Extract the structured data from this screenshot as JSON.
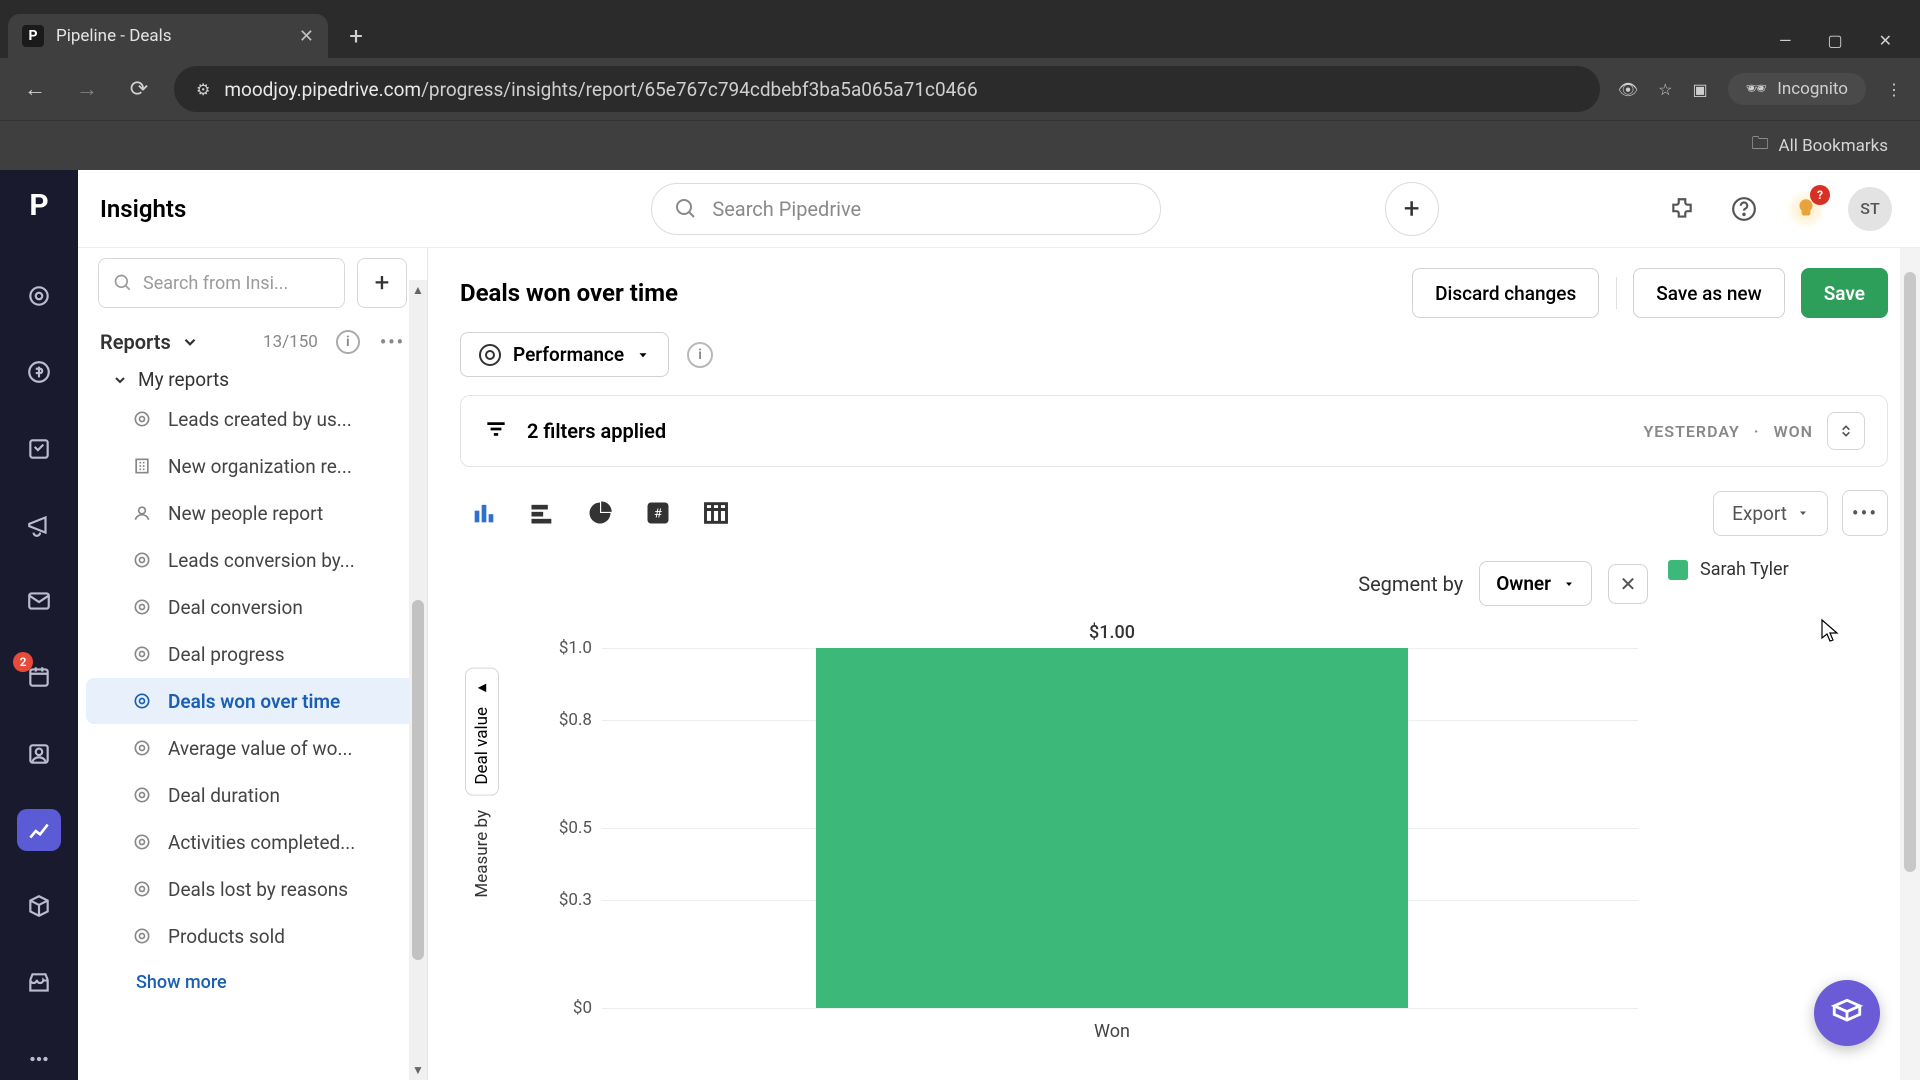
{
  "browser": {
    "tab_title": "Pipeline - Deals",
    "url_host": "moodjoy.pipedrive.com",
    "url_path": "/progress/insights/report/65e767c794cdbebf3ba5a065a71c0466",
    "incognito": "Incognito",
    "all_bookmarks": "All Bookmarks"
  },
  "topbar": {
    "section": "Insights",
    "search_placeholder": "Search Pipedrive",
    "avatar": "ST",
    "bulb_badge": "?"
  },
  "sidebar": {
    "search_placeholder": "Search from Insi...",
    "reports_label": "Reports",
    "reports_count": "13/150",
    "group": "My reports",
    "items": [
      {
        "label": "Leads created by us...",
        "kind": "target"
      },
      {
        "label": "New organization re...",
        "kind": "org"
      },
      {
        "label": "New people report",
        "kind": "people"
      },
      {
        "label": "Leads conversion by...",
        "kind": "target"
      },
      {
        "label": "Deal conversion",
        "kind": "target"
      },
      {
        "label": "Deal progress",
        "kind": "target"
      },
      {
        "label": "Deals won over time",
        "kind": "target"
      },
      {
        "label": "Average value of wo...",
        "kind": "target"
      },
      {
        "label": "Deal duration",
        "kind": "target"
      },
      {
        "label": "Activities completed...",
        "kind": "target"
      },
      {
        "label": "Deals lost by reasons",
        "kind": "target"
      },
      {
        "label": "Products sold",
        "kind": "target"
      }
    ],
    "show_more": "Show more",
    "rail_badge": "2"
  },
  "page": {
    "title": "Deals won over time",
    "discard": "Discard changes",
    "save_as_new": "Save as new",
    "save": "Save",
    "performance": "Performance",
    "filters_text": "2 filters applied",
    "filter_tags": [
      "YESTERDAY",
      "WON"
    ],
    "export": "Export",
    "segment_by": "Segment by",
    "segment_value": "Owner",
    "y_box": "Deal value",
    "y_text": "Measure by",
    "legend": "Sarah Tyler"
  },
  "chart_data": {
    "type": "bar",
    "categories": [
      "Won"
    ],
    "series": [
      {
        "name": "Sarah Tyler",
        "values": [
          1.0
        ]
      }
    ],
    "value_labels": [
      "$1.00"
    ],
    "ylabel": "Deal value",
    "ylim": [
      0,
      1.0
    ],
    "yticks": [
      0,
      0.3,
      0.5,
      0.8,
      1.0
    ],
    "ytick_labels": [
      "$0",
      "$0.3",
      "$0.5",
      "$0.8",
      "$1.0"
    ],
    "color": "#3cb878"
  }
}
